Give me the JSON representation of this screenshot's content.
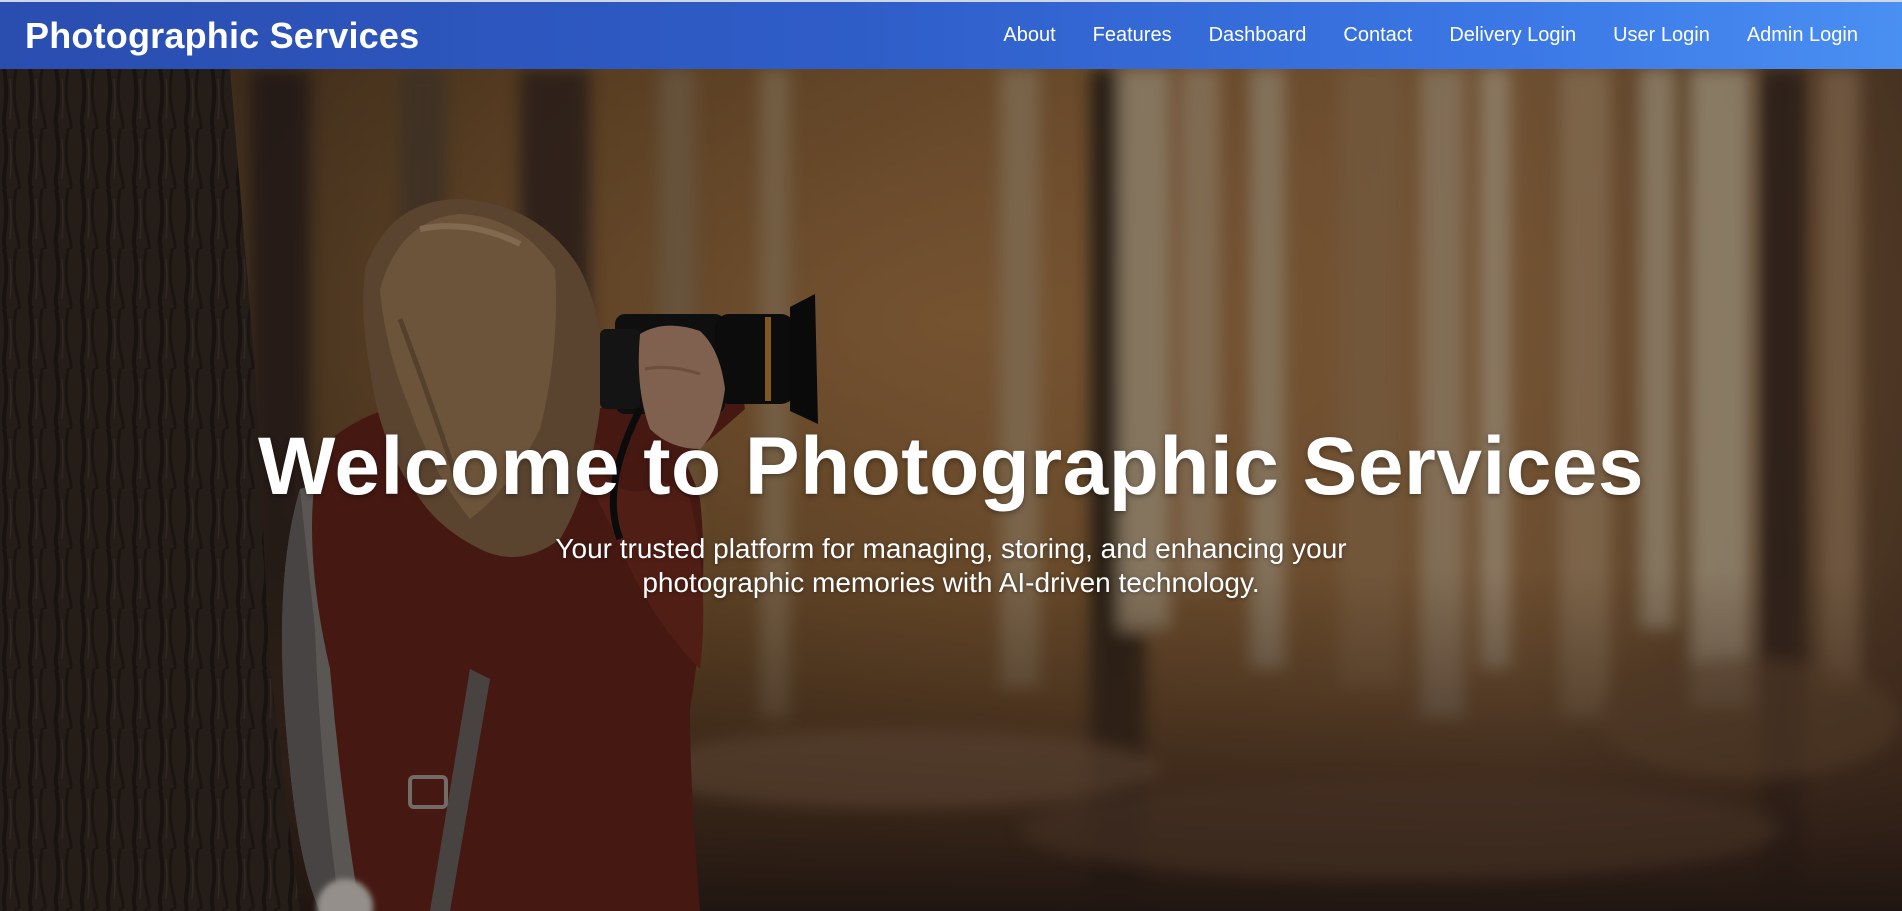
{
  "brand": "Photographic Services",
  "nav": {
    "items": [
      {
        "label": "About"
      },
      {
        "label": "Features"
      },
      {
        "label": "Dashboard"
      },
      {
        "label": "Contact"
      },
      {
        "label": "Delivery Login"
      },
      {
        "label": "User Login"
      },
      {
        "label": "Admin Login"
      }
    ]
  },
  "hero": {
    "title": "Welcome to Photographic Services",
    "subtitle": "Your trusted platform for managing, storing, and enhancing your photographic memories with AI-driven technology.",
    "background": "hero-background-photo-of-photographer-in-autumn-forest"
  },
  "colors": {
    "nav_start": "#2a4db0",
    "nav_end": "#4a8ff2",
    "text": "#ffffff"
  }
}
